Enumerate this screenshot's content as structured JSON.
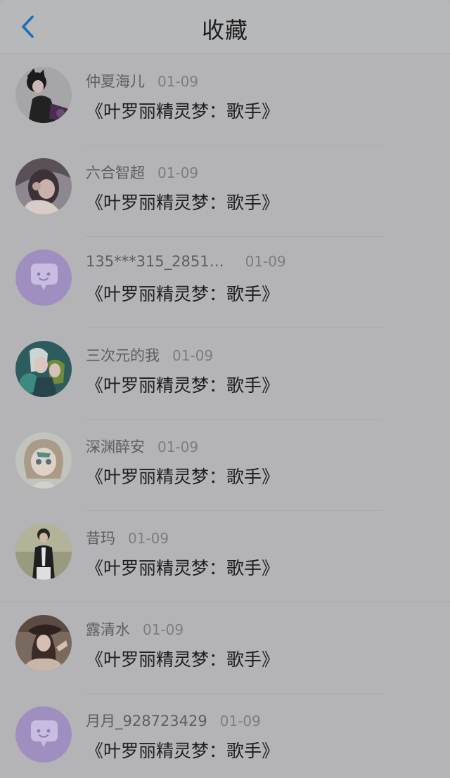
{
  "header": {
    "title": "收藏",
    "back_icon": "chevron-left-icon",
    "accent_color": "#1d6fb5"
  },
  "items": [
    {
      "user": "仲夏海儿",
      "date": "01-09",
      "title": "《叶罗丽精灵梦：歌手》",
      "avatar": "photo-dark-figure"
    },
    {
      "user": "六合智超",
      "date": "01-09",
      "title": "《叶罗丽精灵梦：歌手》",
      "avatar": "photo-girl"
    },
    {
      "user": "135***315_2851…",
      "date": "01-09",
      "title": "《叶罗丽精灵梦：歌手》",
      "avatar": "default-chat-bubble"
    },
    {
      "user": "三次元的我",
      "date": "01-09",
      "title": "《叶罗丽精灵梦：歌手》",
      "avatar": "anime-pair"
    },
    {
      "user": "深渊醉安",
      "date": "01-09",
      "title": "《叶罗丽精灵梦：歌手》",
      "avatar": "anime-girl"
    },
    {
      "user": "昔玛",
      "date": "01-09",
      "title": "《叶罗丽精灵梦：歌手》",
      "avatar": "photo-boy-suit"
    },
    {
      "user": "露清水",
      "date": "01-09",
      "title": "《叶罗丽精灵梦：歌手》",
      "avatar": "photo-girl-hat"
    },
    {
      "user": "月月_928723429",
      "date": "01-09",
      "title": "《叶罗丽精灵梦：歌手》",
      "avatar": "default-chat-bubble"
    }
  ]
}
